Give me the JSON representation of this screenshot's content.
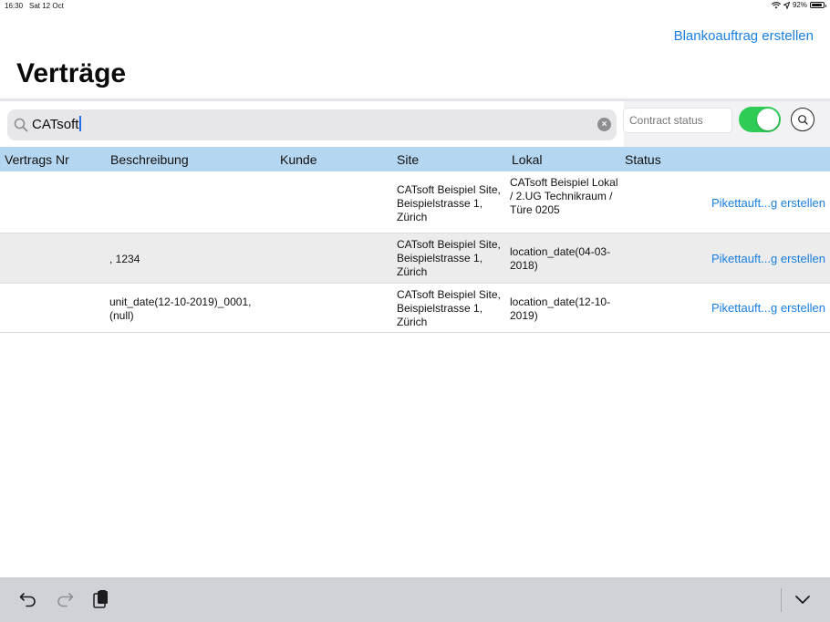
{
  "status_bar": {
    "time": "16:30",
    "date": "Sat 12 Oct",
    "battery": "92%",
    "battery_level": 0.92
  },
  "header": {
    "title": "Verträge",
    "create_blank_label": "Blankoauftrag erstellen"
  },
  "search": {
    "value": "CATsoft",
    "status_placeholder": "Contract status",
    "toggle_on": true
  },
  "table": {
    "columns": [
      "Vertrags Nr",
      "Beschreibung",
      "Kunde",
      "Site",
      "Lokal",
      "Status"
    ],
    "rows": [
      {
        "vertrags_nr": "",
        "beschreibung": "",
        "kunde": "",
        "site": "CATsoft Beispiel Site, Beispielstrasse 1, Zürich",
        "lokal": "CATsoft Beispiel Lokal / 2.UG Technikraum / Türe 0205",
        "status": "",
        "action": "Pikettauft...g erstellen"
      },
      {
        "vertrags_nr": "",
        "beschreibung": ", 1234",
        "kunde": "",
        "site": "CATsoft Beispiel Site, Beispielstrasse 1, Zürich",
        "lokal": "location_date(04-03-2018)",
        "status": "",
        "action": "Pikettauft...g erstellen"
      },
      {
        "vertrags_nr": "",
        "beschreibung": "unit_date(12-10-2019)_0001, (null)",
        "kunde": "",
        "site": "CATsoft Beispiel Site, Beispielstrasse 1, Zürich",
        "lokal": "location_date(12-10-2019)",
        "status": "",
        "action": "Pikettauft...g erstellen"
      }
    ]
  },
  "colors": {
    "accent": "#1a7fe0",
    "header_row": "#b5d6f0",
    "toggle": "#2ecc55"
  }
}
